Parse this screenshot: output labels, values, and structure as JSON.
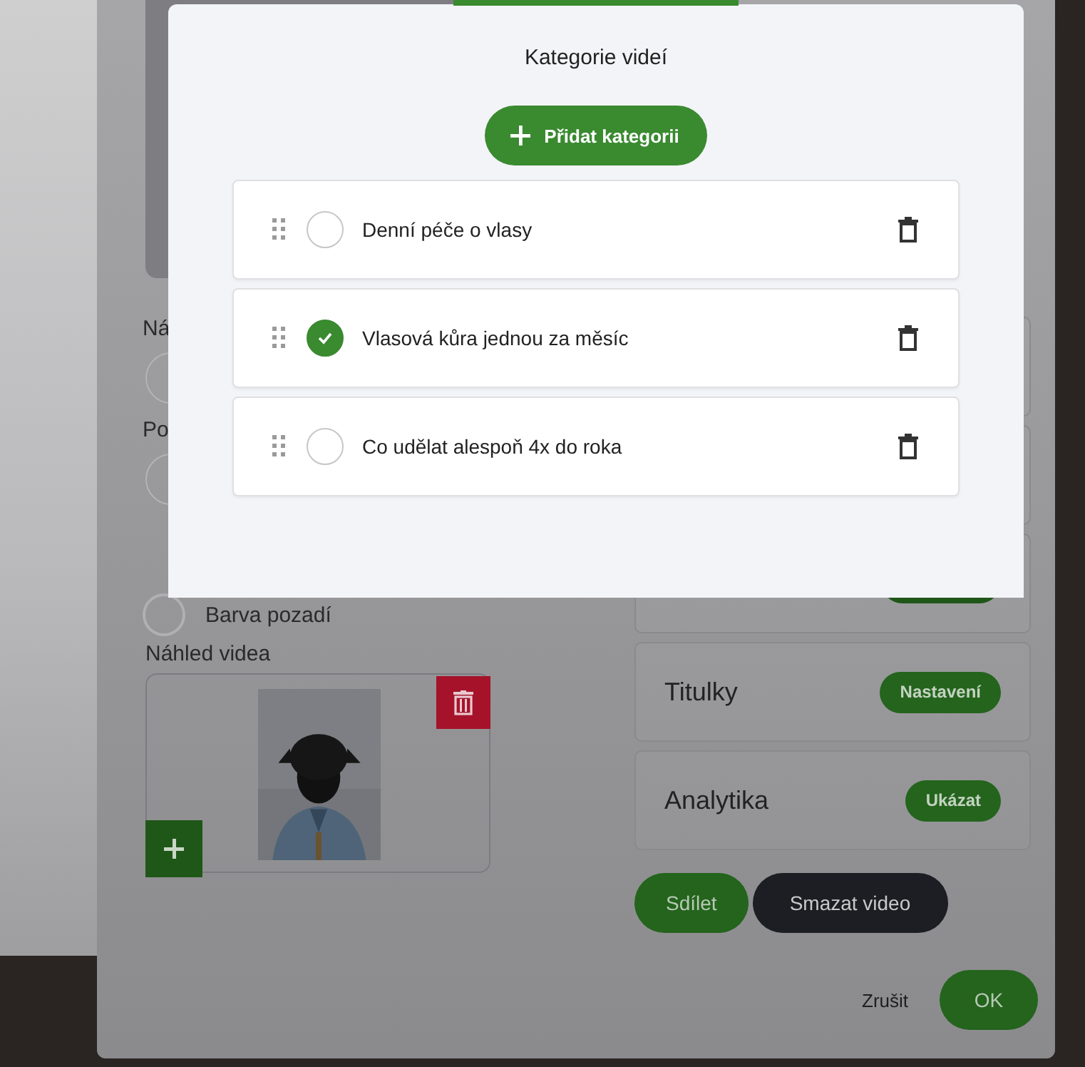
{
  "background": {
    "left_column": {
      "field_labels": [
        "Ná",
        "Po"
      ],
      "background_color_option": {
        "label": "Barva pozadí",
        "selected": false
      },
      "preview": {
        "label": "Náhled videa"
      }
    },
    "right_column": {
      "cards": [
        {
          "title": "Titulky",
          "button": "Nastavení"
        },
        {
          "title": "Analytika",
          "button": "Ukázat"
        }
      ]
    },
    "actions": [
      {
        "label": "Sdílet",
        "kind": "primary"
      },
      {
        "label": "Smazat video",
        "kind": "dark"
      }
    ],
    "footer": {
      "cancel": "Zrušit",
      "ok": "OK"
    }
  },
  "modal": {
    "title": "Kategorie videí",
    "add_button": "Přidat kategorii",
    "categories": [
      {
        "name": "Denní péče o vlasy",
        "selected": false
      },
      {
        "name": "Vlasová kůra jednou za měsíc",
        "selected": true
      },
      {
        "name": "Co udělat alespoň 4x do roka",
        "selected": false
      }
    ]
  }
}
